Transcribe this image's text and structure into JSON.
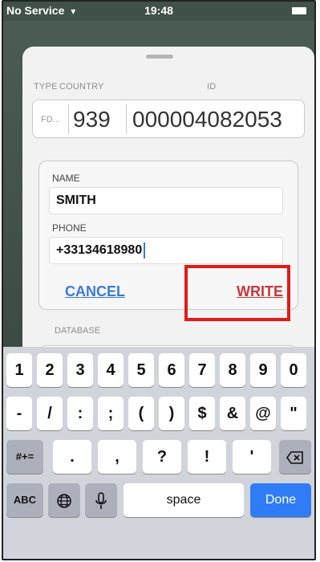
{
  "status_bar": {
    "carrier": "No Service",
    "time": "19:48"
  },
  "card": {
    "headers": {
      "type": "TYPE",
      "country": "COUNTRY",
      "id": "ID"
    },
    "type_value": "FD...",
    "country_value": "939",
    "id_value": "000004082053"
  },
  "form": {
    "name_label": "NAME",
    "name_value": "SMITH",
    "phone_label": "PHONE",
    "phone_value": "+33134618980",
    "cancel_label": "CANCEL",
    "write_label": "WRITE"
  },
  "database_label": "DATABASE",
  "keyboard": {
    "row1": [
      "1",
      "2",
      "3",
      "4",
      "5",
      "6",
      "7",
      "8",
      "9",
      "0"
    ],
    "row2": [
      "-",
      "/",
      ":",
      ";",
      "(",
      ")",
      "$",
      "&",
      "@",
      "\""
    ],
    "row3_left": "#+=",
    "row3": [
      ".",
      ",",
      "?",
      "!",
      "'"
    ],
    "abc": "ABC",
    "space": "space",
    "done": "Done"
  },
  "colors": {
    "accent_blue": "#3b7bd6",
    "write_red": "#c7393a",
    "highlight": "#e21a1a",
    "done_blue": "#2f7cf6"
  }
}
